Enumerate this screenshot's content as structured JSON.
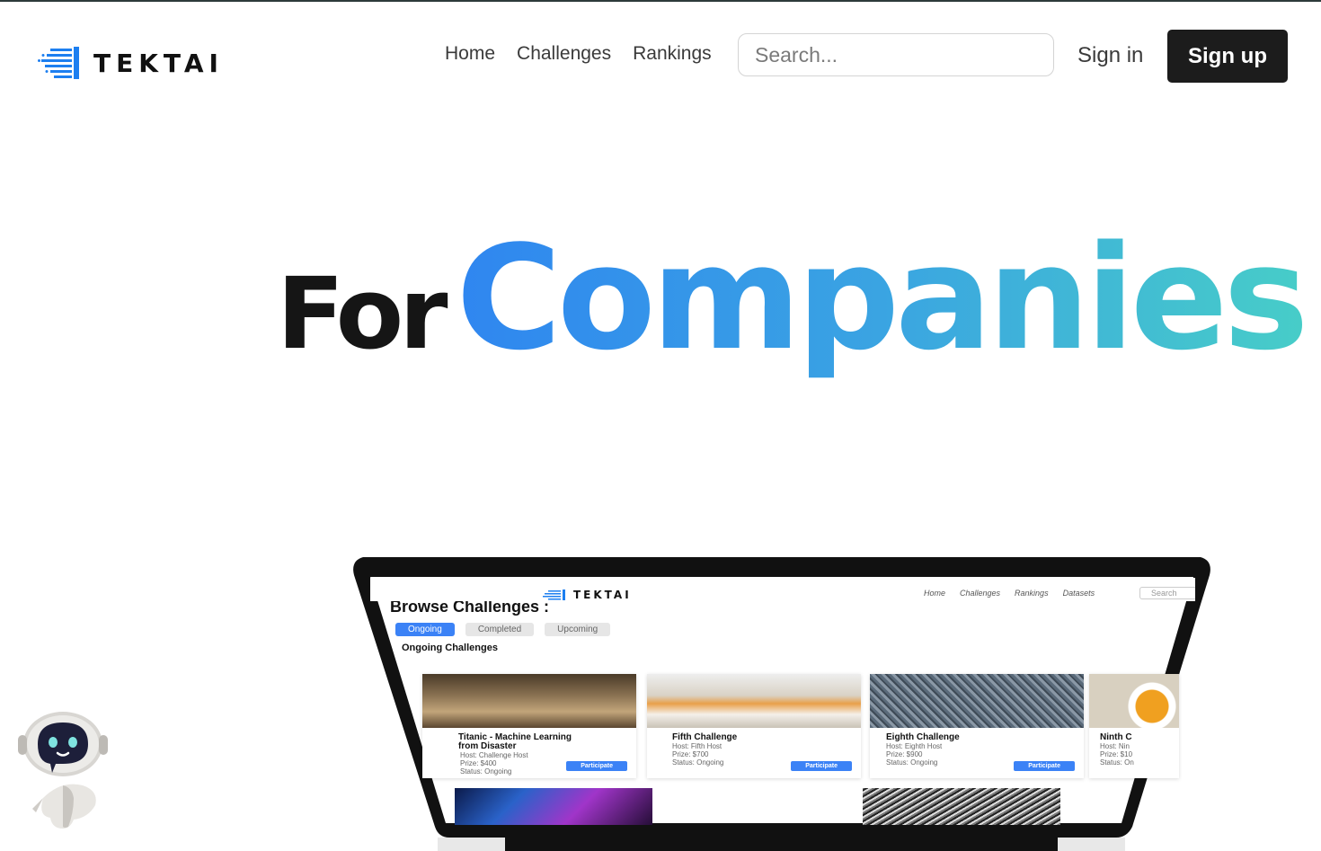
{
  "brand": {
    "name": "TEKTAI"
  },
  "nav": {
    "links": [
      "Home",
      "Challenges",
      "Rankings"
    ]
  },
  "search": {
    "placeholder": "Search..."
  },
  "auth": {
    "signin": "Sign in",
    "signup": "Sign up"
  },
  "hero": {
    "word1": "For",
    "word2": "Companies"
  },
  "preview": {
    "brand": "TEKTAI",
    "links": [
      "Home",
      "Challenges",
      "Rankings",
      "Datasets"
    ],
    "search_placeholder": "Search",
    "heading": "Browse Challenges :",
    "tabs": [
      "Ongoing",
      "Completed",
      "Upcoming"
    ],
    "subheading": "Ongoing Challenges",
    "cards": [
      {
        "title": "Titanic - Machine Learning from Disaster",
        "host": "Host: Challenge Host",
        "prize": "Prize: $400",
        "status": "Status: Ongoing",
        "button": "Participate"
      },
      {
        "title": "Fifth Challenge",
        "host": "Host: Fifth Host",
        "prize": "Prize: $700",
        "status": "Status: Ongoing",
        "button": "Participate"
      },
      {
        "title": "Eighth Challenge",
        "host": "Host: Eighth Host",
        "prize": "Prize: $900",
        "status": "Status: Ongoing",
        "button": "Participate"
      },
      {
        "title": "Ninth C",
        "host": "Host: Nin",
        "prize": "Prize: $10",
        "status": "Status: On",
        "button": ""
      }
    ]
  },
  "colors": {
    "gradient_start": "#2f86f0",
    "gradient_end": "#47cdc8",
    "accent": "#3b82f6",
    "dark": "#1c1c1c"
  }
}
